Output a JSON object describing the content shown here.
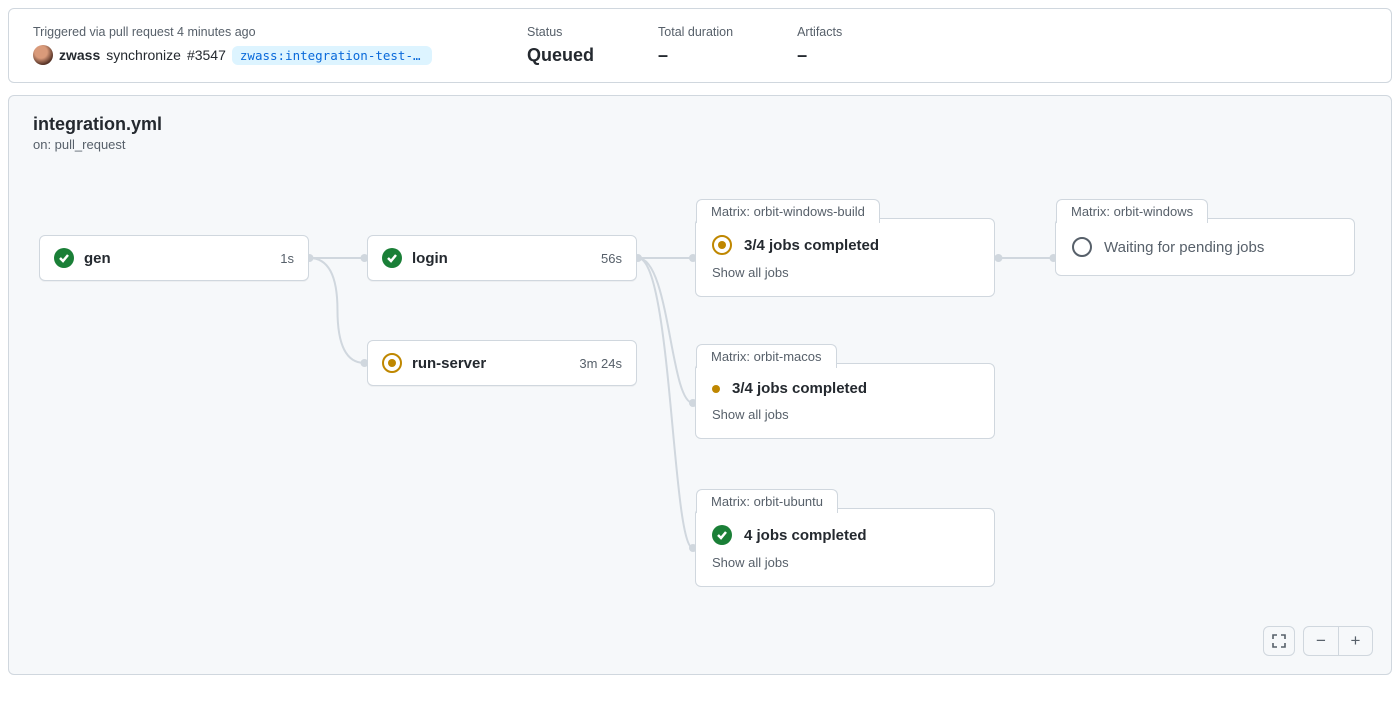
{
  "summary": {
    "trigger": {
      "label": "Triggered via pull request 4 minutes ago",
      "user": "zwass",
      "action": "synchronize",
      "pr": "#3547",
      "branch": "zwass:integration-test-pa…"
    },
    "status": {
      "label": "Status",
      "value": "Queued"
    },
    "duration": {
      "label": "Total duration",
      "value": "–"
    },
    "artifacts": {
      "label": "Artifacts",
      "value": "–"
    }
  },
  "workflow": {
    "name": "integration.yml",
    "on": "on: pull_request"
  },
  "jobs": {
    "gen": {
      "name": "gen",
      "duration": "1s",
      "status": "success"
    },
    "login": {
      "name": "login",
      "duration": "56s",
      "status": "success"
    },
    "run_server": {
      "name": "run-server",
      "duration": "3m 24s",
      "status": "running"
    }
  },
  "matrices": {
    "orbit_windows_build": {
      "tab": "Matrix: orbit-windows-build",
      "title": "3/4 jobs completed",
      "sub": "Show all jobs",
      "status": "running"
    },
    "orbit_macos": {
      "tab": "Matrix: orbit-macos",
      "title": "3/4 jobs completed",
      "sub": "Show all jobs",
      "status": "amber-dot"
    },
    "orbit_ubuntu": {
      "tab": "Matrix: orbit-ubuntu",
      "title": "4 jobs completed",
      "sub": "Show all jobs",
      "status": "success"
    },
    "orbit_windows": {
      "tab": "Matrix: orbit-windows",
      "title": "Waiting for pending jobs",
      "status": "pending"
    }
  }
}
